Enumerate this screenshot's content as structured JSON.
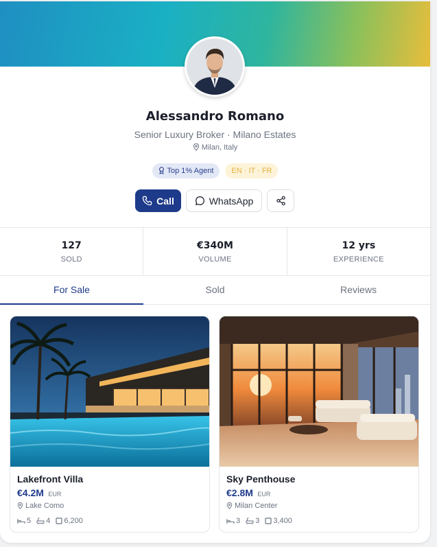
{
  "profile": {
    "name": "Alessandro Romano",
    "title": "Senior Luxury Broker · Milano Estates",
    "location": "Milan, Italy",
    "badges": {
      "top_agent": "Top 1% Agent",
      "languages": "EN · IT · FR"
    }
  },
  "actions": {
    "call": "Call",
    "whatsapp": "WhatsApp",
    "share_icon": "share-icon"
  },
  "stats": [
    {
      "value": "127",
      "label": "SOLD"
    },
    {
      "value": "€340M",
      "label": "VOLUME"
    },
    {
      "value": "12 yrs",
      "label": "EXPERIENCE"
    }
  ],
  "tabs": [
    {
      "label": "For Sale",
      "active": true
    },
    {
      "label": "Sold",
      "active": false
    },
    {
      "label": "Reviews",
      "active": false
    }
  ],
  "listings": [
    {
      "name": "Lakefront Villa",
      "price": "€4.2M",
      "currency": "EUR",
      "location": "Lake Como",
      "beds": "5",
      "baths": "4",
      "area": "6,200"
    },
    {
      "name": "Sky Penthouse",
      "price": "€2.8M",
      "currency": "EUR",
      "location": "Milan Center",
      "beds": "3",
      "baths": "3",
      "area": "3,400"
    }
  ],
  "colors": {
    "brand": "#1e3a8a",
    "badge_gold": "#e2b23f",
    "text_muted": "#6b7280"
  }
}
